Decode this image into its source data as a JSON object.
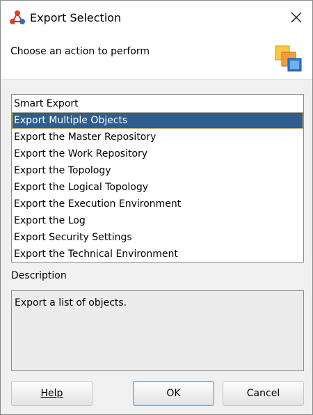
{
  "window": {
    "title": "Export Selection",
    "icon": "export-app-icon",
    "close_icon": "close-icon"
  },
  "header": {
    "prompt": "Choose an action to perform",
    "icon": "export-wizard-icon"
  },
  "actions": {
    "items": [
      {
        "label": "Smart Export",
        "selected": false
      },
      {
        "label": "Export Multiple Objects",
        "selected": true
      },
      {
        "label": "Export the Master Repository",
        "selected": false
      },
      {
        "label": "Export the Work Repository",
        "selected": false
      },
      {
        "label": "Export the Topology",
        "selected": false
      },
      {
        "label": "Export the Logical Topology",
        "selected": false
      },
      {
        "label": "Export the Execution Environment",
        "selected": false
      },
      {
        "label": "Export the Log",
        "selected": false
      },
      {
        "label": "Export Security Settings",
        "selected": false
      },
      {
        "label": "Export the Technical Environment",
        "selected": false
      }
    ]
  },
  "description": {
    "label": "Description",
    "text": "Export a list of objects."
  },
  "buttons": {
    "help": "Help",
    "ok": "OK",
    "cancel": "Cancel"
  },
  "colors": {
    "selection_bg": "#2f5e8e",
    "selection_border": "#d6a84e",
    "dialog_bg": "#f0f0f0"
  }
}
